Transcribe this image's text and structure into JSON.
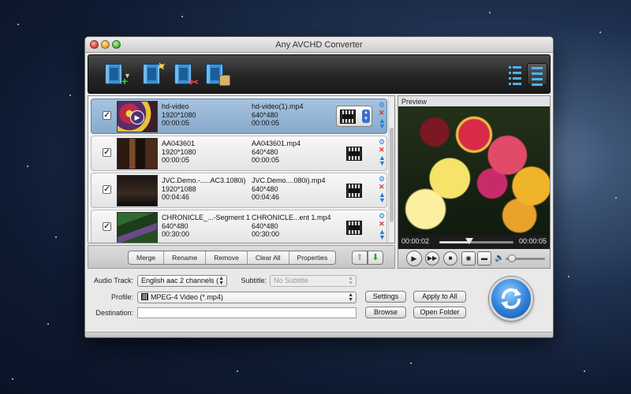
{
  "window": {
    "title": "Any AVCHD Converter"
  },
  "toolbar": {
    "buttons": [
      {
        "icon": "add-file-icon"
      },
      {
        "icon": "edit-icon"
      },
      {
        "icon": "clip-icon"
      },
      {
        "icon": "merge-icon"
      }
    ],
    "views": [
      "list-view-icon",
      "detail-view-icon"
    ]
  },
  "files": [
    {
      "checked": true,
      "selected": true,
      "source": {
        "name": "hd-video",
        "resolution": "1920*1080",
        "duration": "00:00:05"
      },
      "output": {
        "name": "hd-video(1).mp4",
        "resolution": "640*480",
        "duration": "00:00:05"
      }
    },
    {
      "checked": true,
      "selected": false,
      "source": {
        "name": "AA043601",
        "resolution": "1920*1080",
        "duration": "00:00:05"
      },
      "output": {
        "name": "AA043601.mp4",
        "resolution": "640*480",
        "duration": "00:00:05"
      }
    },
    {
      "checked": true,
      "selected": false,
      "source": {
        "name": "JVC.Demo.-.....AC3.1080i)",
        "resolution": "1920*1088",
        "duration": "00:04:46"
      },
      "output": {
        "name": "JVC.Demo....080i).mp4",
        "resolution": "640*480",
        "duration": "00:04:46"
      }
    },
    {
      "checked": true,
      "selected": false,
      "source": {
        "name": "CHRONICLE_...-Segment 1",
        "resolution": "640*480",
        "duration": "00:30:00"
      },
      "output": {
        "name": "CHRONICLE...ent 1.mp4",
        "resolution": "640*480",
        "duration": "00:30:00"
      }
    }
  ],
  "list_actions": {
    "merge": "Merge",
    "rename": "Rename",
    "remove": "Remove",
    "clear_all": "Clear All",
    "properties": "Properties"
  },
  "preview": {
    "label": "Preview",
    "current_time": "00:00:02",
    "total_time": "00:00:05",
    "progress": 0.4,
    "volume": 0.15
  },
  "settings": {
    "audio_track_label": "Audio Track:",
    "audio_track_value": "English aac 2 channels (",
    "subtitle_label": "Subtitle:",
    "subtitle_value": "No Subtitle",
    "profile_label": "Profile:",
    "profile_value": "MPEG-4 Video (*.mp4)",
    "destination_label": "Destination:",
    "destination_value": "",
    "settings_btn": "Settings",
    "apply_all_btn": "Apply to All",
    "browse_btn": "Browse",
    "open_folder_btn": "Open Folder"
  }
}
